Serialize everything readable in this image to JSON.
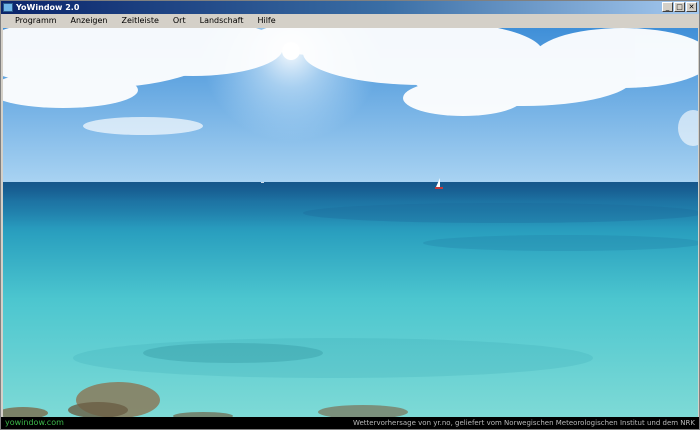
{
  "window": {
    "title": "YoWindow 2.0"
  },
  "menu": [
    "Programm",
    "Anzeigen",
    "Zeitleiste",
    "Ort",
    "Landschaft",
    "Hilfe"
  ],
  "titlebar_buttons": {
    "minimize": "_",
    "maximize": "□",
    "close": "✕"
  },
  "status": {
    "link": "yowindow.com",
    "credit": "Wettervorhersage von yr.no, geliefert vom Norwegischen Meteorologischen Institut und dem NRK"
  }
}
